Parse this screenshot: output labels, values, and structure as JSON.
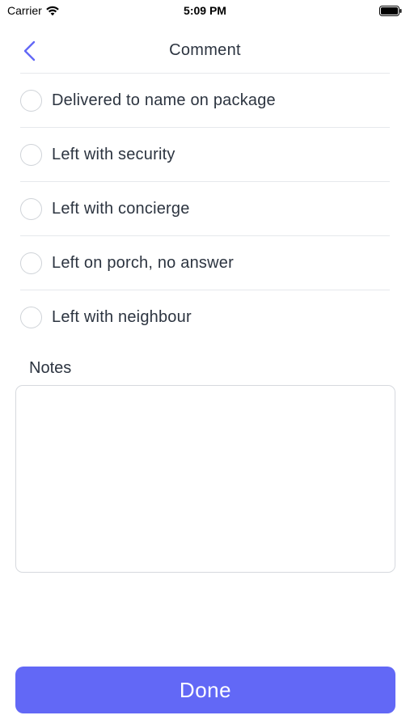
{
  "status_bar": {
    "carrier": "Carrier",
    "time": "5:09 PM"
  },
  "nav": {
    "title": "Comment",
    "back_icon": "chevron-left-icon"
  },
  "options": [
    {
      "label": "Delivered to name on package",
      "selected": false
    },
    {
      "label": "Left with security",
      "selected": false
    },
    {
      "label": "Left with concierge",
      "selected": false
    },
    {
      "label": "Left on porch, no answer",
      "selected": false
    },
    {
      "label": "Left with neighbour",
      "selected": false
    }
  ],
  "notes": {
    "label": "Notes",
    "value": "",
    "placeholder": ""
  },
  "done_button": {
    "label": "Done"
  },
  "colors": {
    "accent": "#6268f6",
    "text": "#2c3440",
    "divider": "#e6e8ec",
    "radio_border": "#cfd3d8"
  }
}
